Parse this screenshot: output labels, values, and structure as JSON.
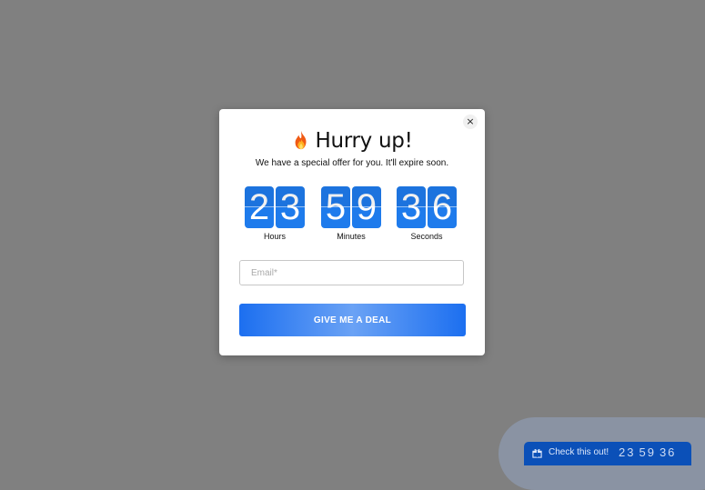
{
  "modal": {
    "title": "Hurry up!",
    "subtitle": "We have a special offer for you. It'll expire soon.",
    "close_label": "×",
    "countdown": {
      "hours": {
        "d1": "2",
        "d2": "3",
        "label": "Hours"
      },
      "minutes": {
        "d1": "5",
        "d2": "9",
        "label": "Minutes"
      },
      "seconds": {
        "d1": "3",
        "d2": "6",
        "label": "Seconds"
      }
    },
    "email_placeholder": "Email*",
    "email_value": "",
    "cta_label": "GIVE ME A DEAL"
  },
  "teaser": {
    "label": "Check this out!",
    "hours": "23",
    "minutes": "59",
    "seconds": "36"
  },
  "colors": {
    "overlay": "#808080",
    "digit_bg": "#1e7bec",
    "cta": "#1c6ff0",
    "teaser_bg": "#0b50b8"
  },
  "icons": {
    "title_icon": "fire-icon",
    "teaser_icon": "gift-icon"
  }
}
